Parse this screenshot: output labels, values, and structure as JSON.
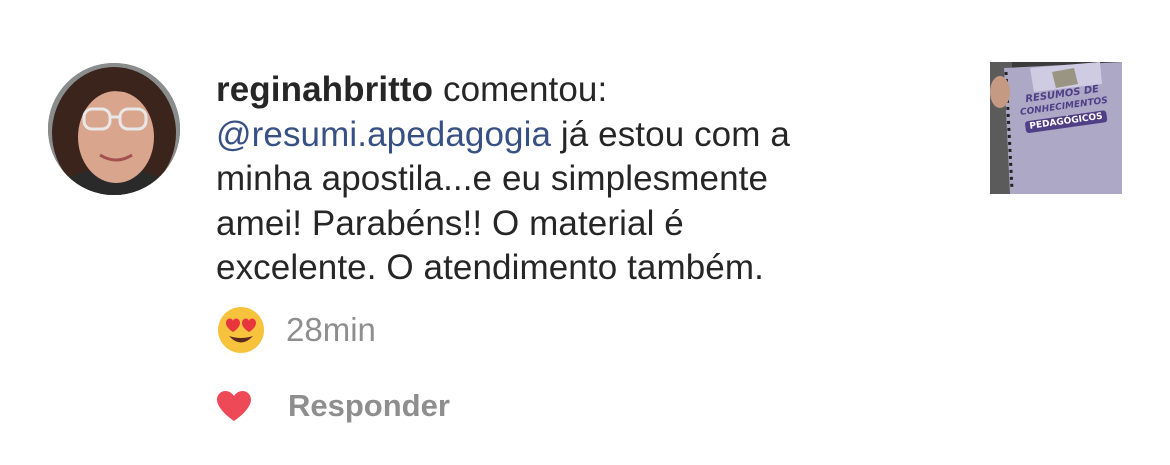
{
  "comment": {
    "username": "reginahbritto",
    "action": "comentou:",
    "mention": "@resumi.apedagogia",
    "line1_rest": "já estou com a",
    "line2": "minha apostila...e eu simplesmente",
    "line3": "amei! Parabéns!! O material é",
    "line4": "excelente. O atendimento também.",
    "emoji": "heart-eyes-emoji",
    "time": "28min"
  },
  "actions": {
    "like_icon": "heart-icon",
    "like_color": "#ed4956",
    "reply_label": "Responder"
  },
  "thumbnail": {
    "title_line1": "RESUMOS DE",
    "title_line2": "CONHECIMENTOS",
    "title_line3": "PEDAGÓGICOS"
  },
  "colors": {
    "text": "#262626",
    "mention": "#385185",
    "secondary": "#8e8e8e"
  }
}
